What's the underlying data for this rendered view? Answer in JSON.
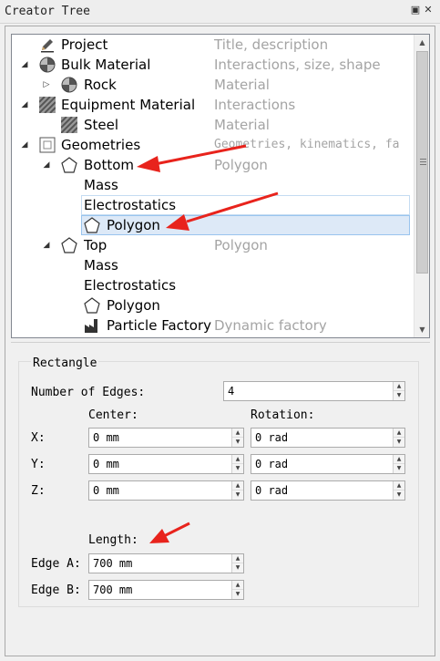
{
  "window": {
    "title": "Creator Tree",
    "float_icon": "restore-icon",
    "close_icon": "close-icon"
  },
  "tree": {
    "rows": [
      {
        "label": "Project",
        "desc": "Title, description",
        "icon": "pencil-icon"
      },
      {
        "label": "Bulk Material",
        "desc": "Interactions, size, shape",
        "icon": "checker-sphere-icon"
      },
      {
        "label": "Rock",
        "desc": "Material",
        "icon": "checker-sphere-icon"
      },
      {
        "label": "Equipment Material",
        "desc": "Interactions",
        "icon": "hatched-square-icon"
      },
      {
        "label": "Steel",
        "desc": "Material",
        "icon": "hatched-square-icon"
      },
      {
        "label": "Geometries",
        "desc": "Geometries, kinematics, fa",
        "icon": "square-outline-icon"
      },
      {
        "label": "Bottom",
        "desc": "Polygon",
        "icon": "pentagon-icon"
      },
      {
        "label": "Mass",
        "desc": ""
      },
      {
        "label": "Electrostatics",
        "desc": ""
      },
      {
        "label": "Polygon",
        "desc": "",
        "icon": "pentagon-icon"
      },
      {
        "label": "Top",
        "desc": "Polygon",
        "icon": "pentagon-icon"
      },
      {
        "label": "Mass",
        "desc": ""
      },
      {
        "label": "Electrostatics",
        "desc": ""
      },
      {
        "label": "Polygon",
        "desc": "",
        "icon": "pentagon-icon"
      },
      {
        "label": "Particle Factory",
        "desc": "Dynamic factory",
        "icon": "factory-icon"
      }
    ]
  },
  "form": {
    "group_title": "Rectangle",
    "num_edges_label": "Number of Edges:",
    "num_edges_value": "4",
    "center_label": "Center:",
    "rotation_label": "Rotation:",
    "x_label": "X:",
    "y_label": "Y:",
    "z_label": "Z:",
    "center_x": "0 mm",
    "center_y": "0 mm",
    "center_z": "0 mm",
    "rot_x": "0 rad",
    "rot_y": "0 rad",
    "rot_z": "0 rad",
    "length_label": "Length:",
    "edge_a_label": "Edge A:",
    "edge_b_label": "Edge B:",
    "edge_a": "700 mm",
    "edge_b": "700 mm"
  },
  "colors": {
    "annotation_arrow": "#e8231c",
    "selection": "#dde9f7",
    "description_text": "#a4a4a4"
  }
}
